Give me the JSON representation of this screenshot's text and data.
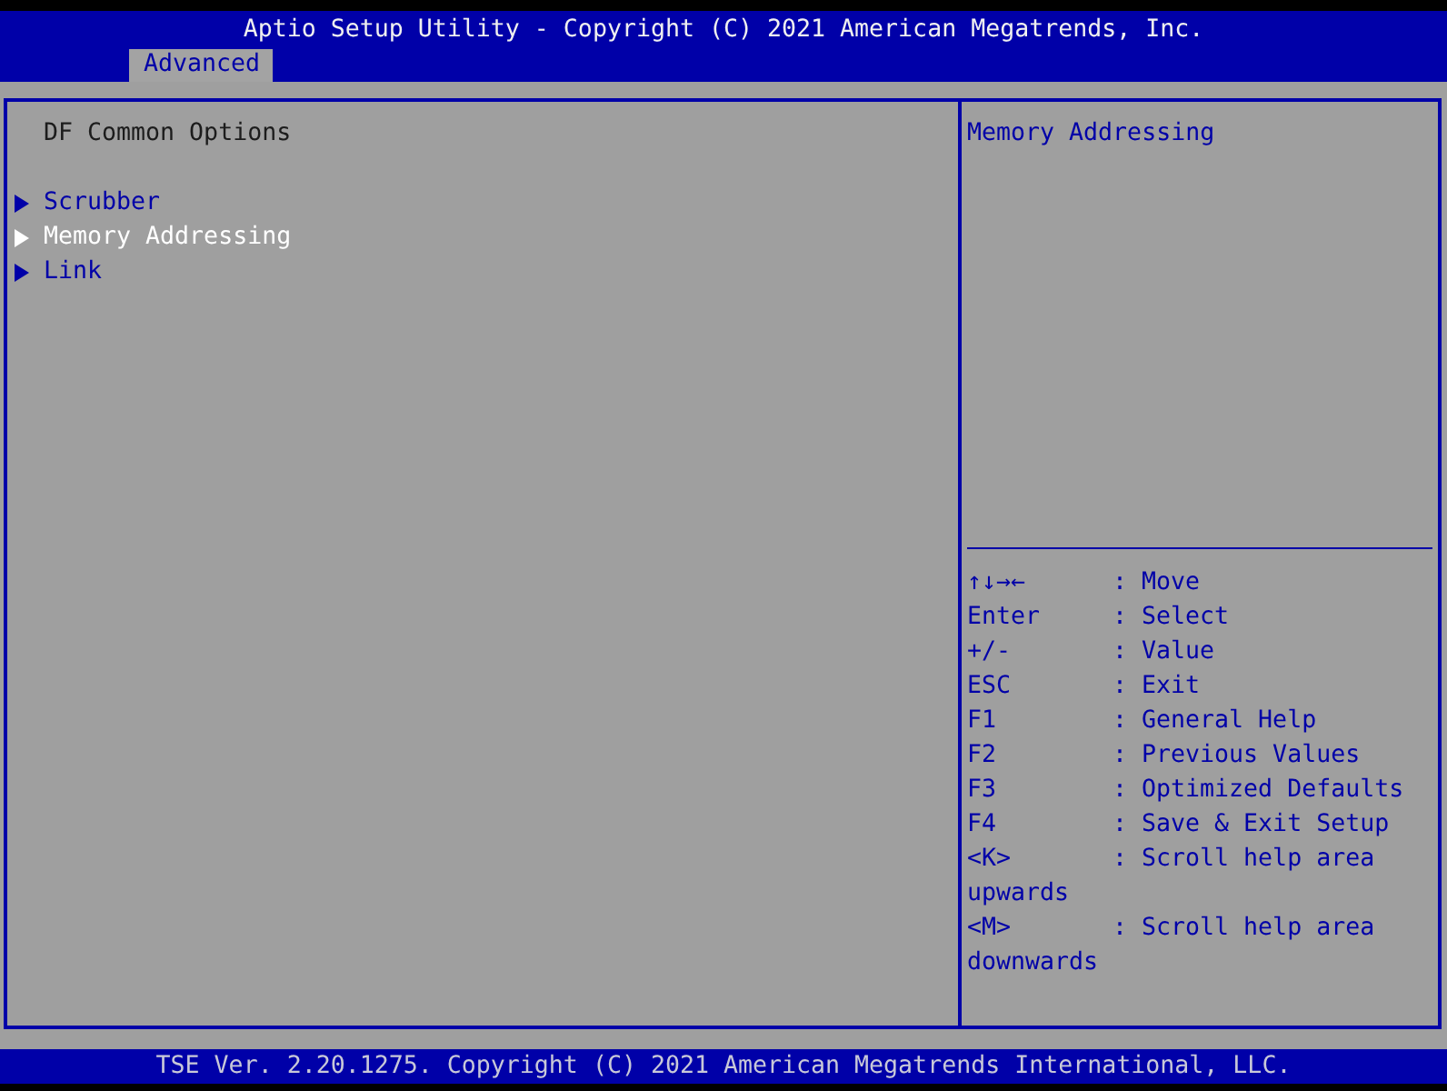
{
  "header": {
    "title": "Aptio Setup Utility - Copyright (C) 2021 American Megatrends, Inc."
  },
  "tabs": [
    {
      "label": "Advanced",
      "selected": true
    }
  ],
  "page": {
    "heading": "DF Common Options",
    "items": [
      {
        "label": "Scrubber",
        "selected": false
      },
      {
        "label": "Memory Addressing",
        "selected": true
      },
      {
        "label": "Link",
        "selected": false
      }
    ]
  },
  "help": {
    "text": "Memory Addressing",
    "keys": [
      {
        "key": "↑↓→←",
        "action": ": Move"
      },
      {
        "key": "Enter",
        "action": ": Select"
      },
      {
        "key": "+/-",
        "action": ": Value"
      },
      {
        "key": "ESC",
        "action": ": Exit"
      },
      {
        "key": "F1",
        "action": ": General Help"
      },
      {
        "key": "F2",
        "action": ": Previous Values"
      },
      {
        "key": "F3",
        "action": ": Optimized Defaults"
      },
      {
        "key": "F4",
        "action": ": Save & Exit Setup"
      },
      {
        "key": "<K>",
        "action": ": Scroll help area",
        "continued": "upwards"
      },
      {
        "key": "<M>",
        "action": ": Scroll help area",
        "continued": "downwards"
      }
    ]
  },
  "footer": {
    "text": "TSE Ver. 2.20.1275. Copyright (C) 2021 American Megatrends International, LLC."
  }
}
